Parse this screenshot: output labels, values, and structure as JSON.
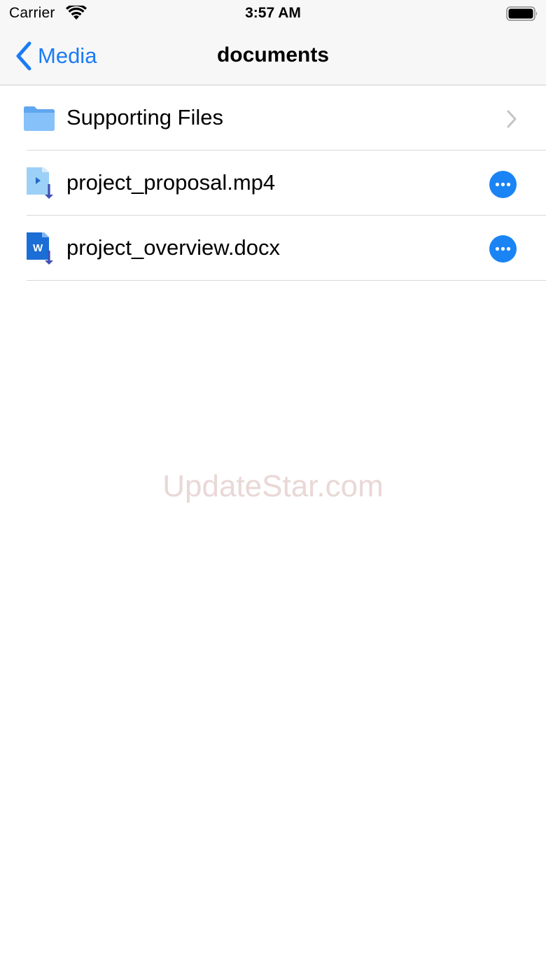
{
  "status_bar": {
    "carrier": "Carrier",
    "time": "3:57 AM",
    "icons": [
      "wifi-icon",
      "battery-icon"
    ]
  },
  "nav": {
    "back_label": "Media",
    "title": "documents",
    "accent_color": "#1a7cf5"
  },
  "items": [
    {
      "label": "Supporting Files",
      "icon": "folder-icon",
      "accessory": "chevron-right-icon"
    },
    {
      "label": "project_proposal.mp4",
      "icon": "video-file-icon",
      "accessory": "more-options-button"
    },
    {
      "label": "project_overview.docx",
      "icon": "word-document-icon",
      "accessory": "more-options-button"
    }
  ],
  "watermark": "UpdateStar.com"
}
